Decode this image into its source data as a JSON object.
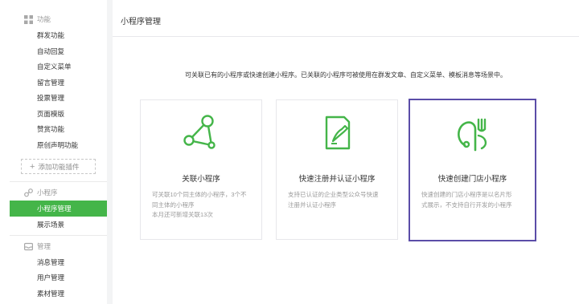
{
  "sidebar": {
    "features": {
      "title": "功能",
      "items": [
        {
          "label": "群发功能"
        },
        {
          "label": "自动回复"
        },
        {
          "label": "自定义菜单"
        },
        {
          "label": "留言管理"
        },
        {
          "label": "投票管理"
        },
        {
          "label": "页面模版"
        },
        {
          "label": "赞赏功能"
        },
        {
          "label": "原创声明功能"
        }
      ],
      "add_plugin_label": "添加功能插件"
    },
    "miniprogram": {
      "title": "小程序",
      "items": [
        {
          "label": "小程序管理",
          "active": true
        },
        {
          "label": "展示场景"
        }
      ]
    },
    "management": {
      "title": "管理",
      "items": [
        {
          "label": "消息管理"
        },
        {
          "label": "用户管理"
        },
        {
          "label": "素材管理"
        }
      ]
    }
  },
  "header": {
    "title": "小程序管理"
  },
  "intro_text": "可关联已有的小程序或快速创建小程序。已关联的小程序可被使用在群发文章、自定义菜单、模板消息等场景中。",
  "cards": [
    {
      "title": "关联小程序",
      "icon": "link-nodes-icon",
      "desc_lines": [
        "可关联10个同主体的小程序，3个不",
        "同主体的小程序",
        "本月还可新增关联13次"
      ]
    },
    {
      "title": "快速注册并认证小程序",
      "icon": "register-document-icon",
      "desc_lines": [
        "支持已认证的企业类型公众号快速",
        "注册并认证小程序"
      ]
    },
    {
      "title": "快速创建门店小程序",
      "icon": "store-fork-icon",
      "selected": true,
      "desc_lines": [
        "快速创建的门店小程序是以名片形",
        "式展示，不支持自行开发的小程序"
      ]
    }
  ],
  "colors": {
    "accent_green": "#44b549",
    "selected_border": "#5b4da8",
    "muted_text": "#9a9a9a"
  }
}
